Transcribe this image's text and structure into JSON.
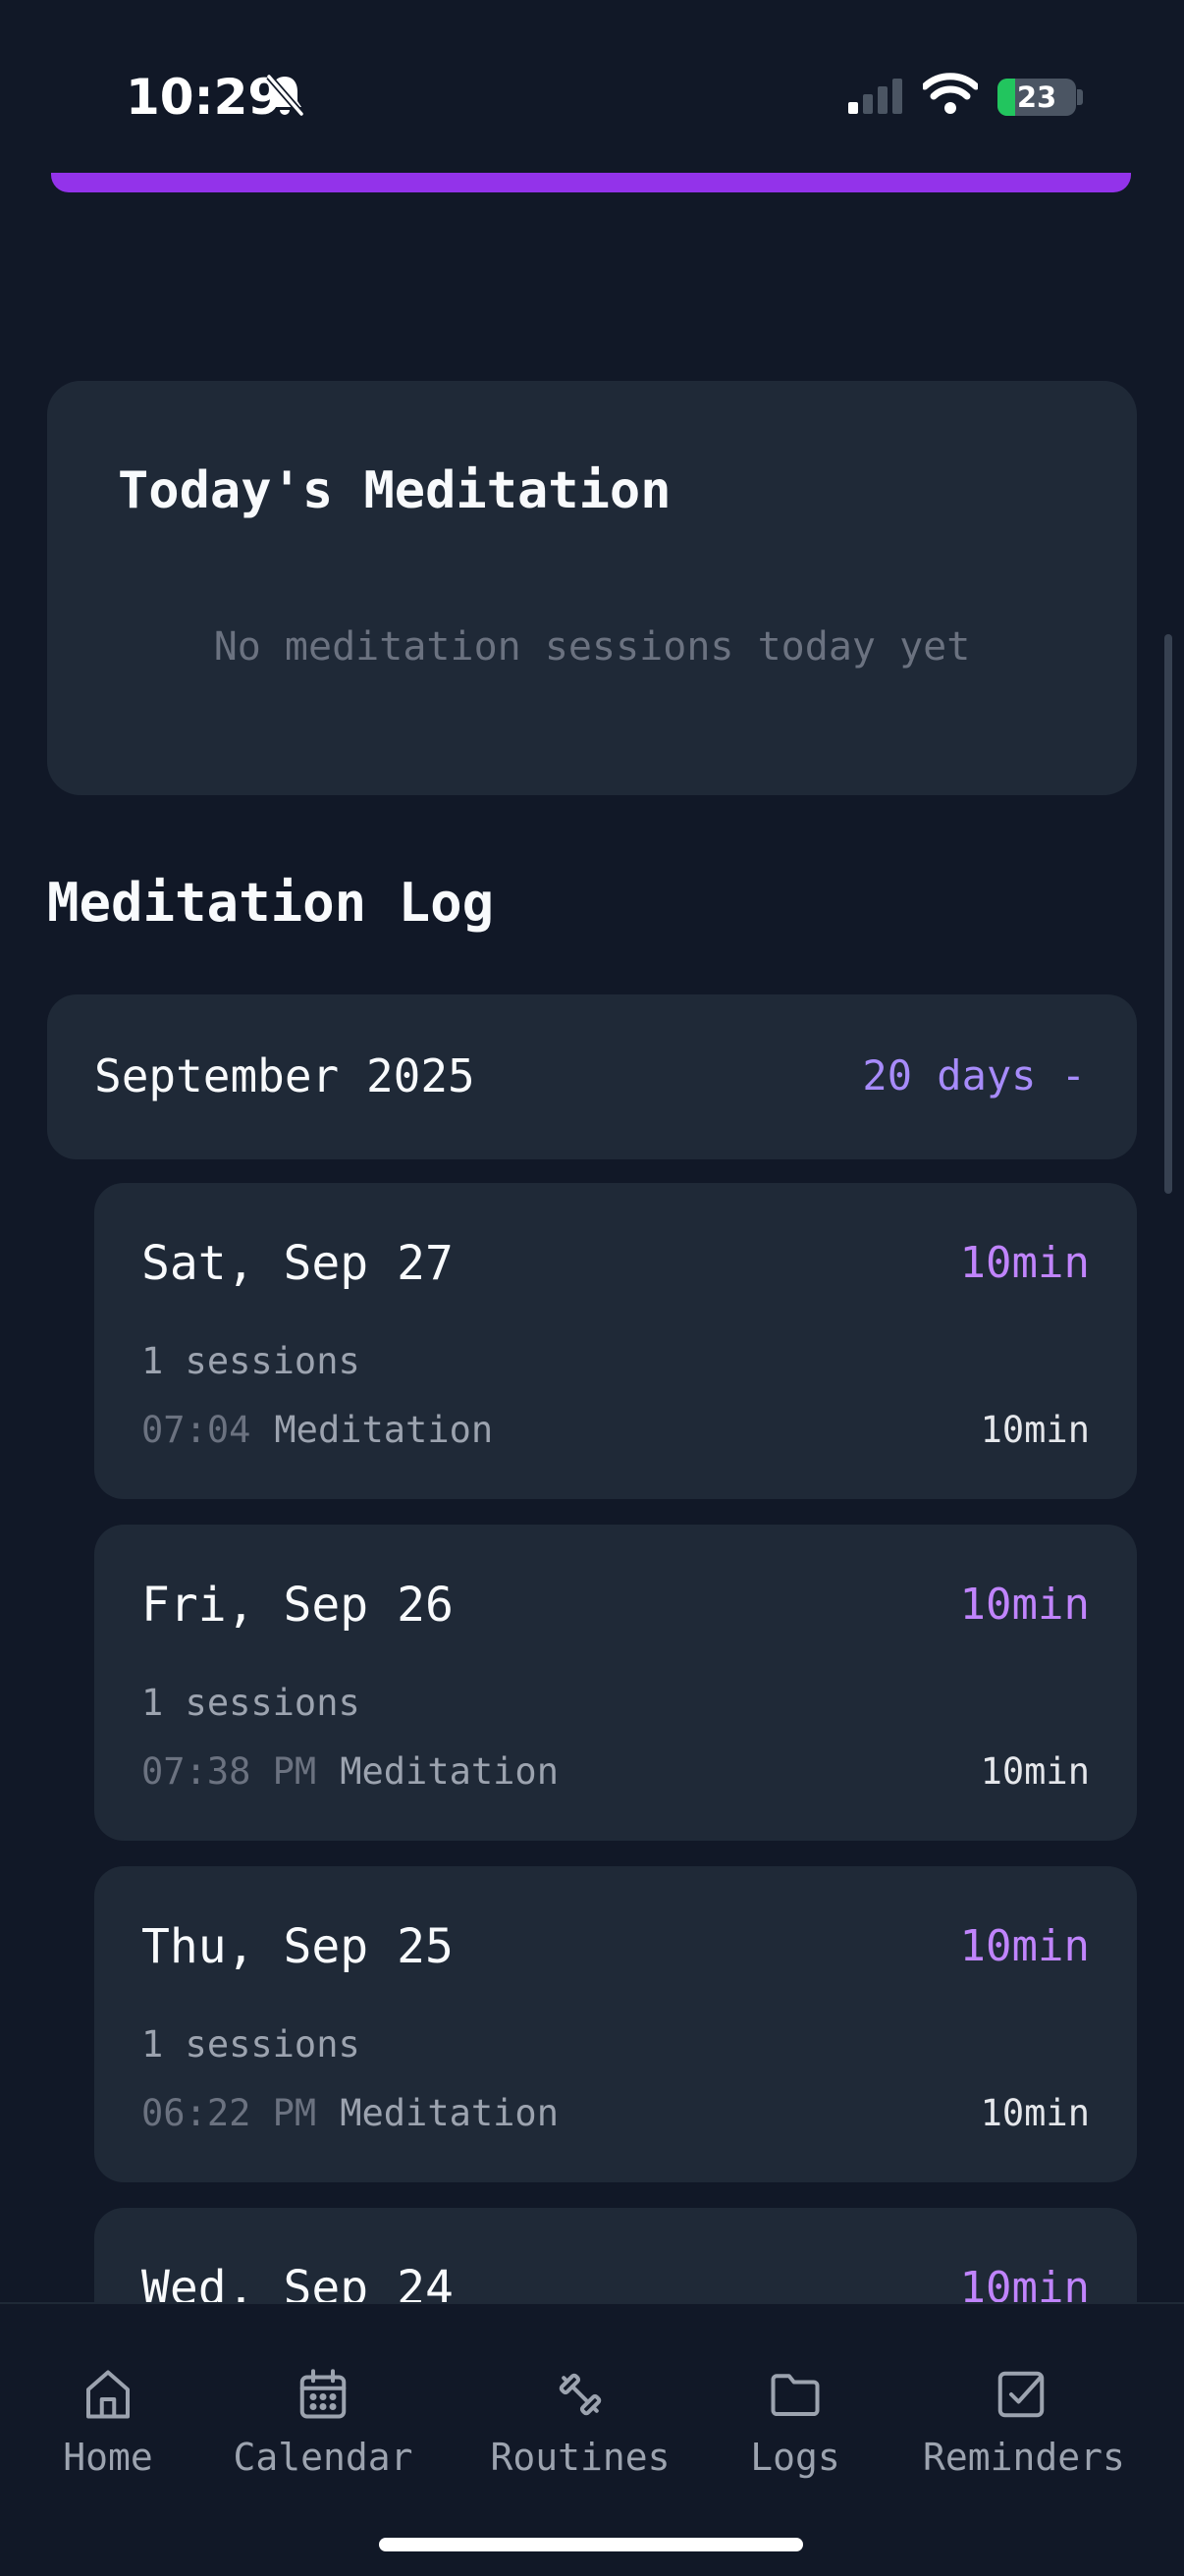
{
  "status": {
    "time": "10:29",
    "battery": "23"
  },
  "today": {
    "title": "Today's Meditation",
    "empty_text": "No meditation sessions today yet"
  },
  "log": {
    "heading": "Meditation Log",
    "month": {
      "label": "September 2025",
      "count": "20 days -"
    },
    "entries": [
      {
        "day": "Sat, Sep 27",
        "total": "10min",
        "sessions": "1 sessions",
        "time": "07:04",
        "name": "Meditation",
        "duration": "10min"
      },
      {
        "day": "Fri, Sep 26",
        "total": "10min",
        "sessions": "1 sessions",
        "time": "07:38 PM",
        "name": "Meditation",
        "duration": "10min"
      },
      {
        "day": "Thu, Sep 25",
        "total": "10min",
        "sessions": "1 sessions",
        "time": "06:22 PM",
        "name": "Meditation",
        "duration": "10min"
      },
      {
        "day": "Wed, Sep 24",
        "total": "10min"
      }
    ]
  },
  "nav": {
    "items": [
      {
        "label": "Home",
        "icon": "home-icon"
      },
      {
        "label": "Calendar",
        "icon": "calendar-icon"
      },
      {
        "label": "Routines",
        "icon": "dumbbell-icon"
      },
      {
        "label": "Logs",
        "icon": "folder-icon"
      },
      {
        "label": "Reminders",
        "icon": "checkbox-icon"
      }
    ]
  },
  "colors": {
    "accent": "#9333ea",
    "accent_text": "#c084fc",
    "background": "#111827",
    "card": "#1f2937"
  }
}
